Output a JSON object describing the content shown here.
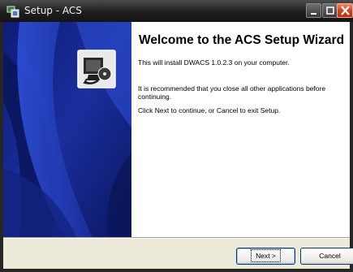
{
  "window": {
    "title": "Setup - ACS",
    "icon": "setup-app-icon",
    "controls": [
      "minimize-icon",
      "maximize-icon",
      "close-icon"
    ]
  },
  "banner": {
    "icon": "computer-cd-install-icon",
    "colors": {
      "dark": "#0a1660",
      "mid": "#1a2e9c",
      "light": "#2d4bd0"
    }
  },
  "content": {
    "title": "Welcome to the ACS Setup Wizard",
    "paragraph1": "This will install DWACS 1.0.2.3 on your computer.",
    "paragraph2": "It is recommended that you close all other applications before continuing.",
    "paragraph3": "Click Next to continue, or Cancel to exit Setup."
  },
  "buttons": {
    "next_label": "Next >",
    "cancel_label": "Cancel"
  }
}
